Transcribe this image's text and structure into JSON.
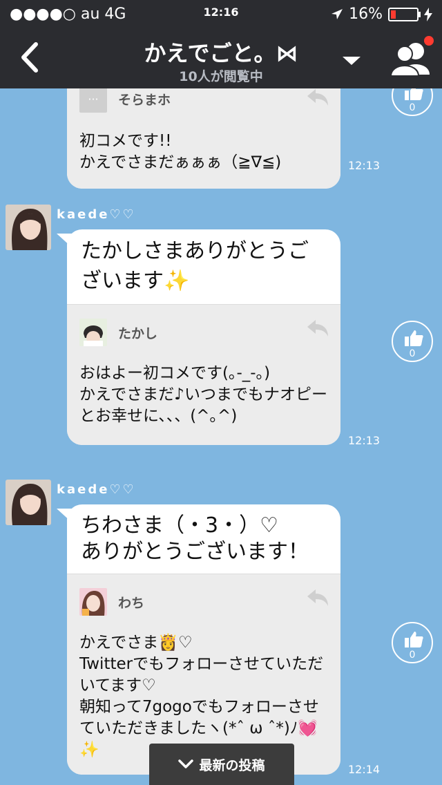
{
  "status": {
    "carrier": "●●●●○ au  4G",
    "time": "12:16",
    "battery_pct": "16%"
  },
  "nav": {
    "title": "かえでごと。⋈",
    "subtitle": "10人が閲覧中"
  },
  "posts": [
    {
      "reply_name": "そらまホ",
      "reply_text": "初コメです!!\nかえでさまだぁぁぁ（≧∇≦)",
      "time": "12:13",
      "likes": "0"
    },
    {
      "poster": "kaede♡♡",
      "main_text": "たかしさまありがとうございます✨",
      "reply_name": "たかし",
      "reply_text": "おはよー初コメです(｡-_-｡)\nかえでさまだ♪いつまでもナオピーとお幸せに、、、(^｡^)",
      "time": "12:13",
      "likes": "0"
    },
    {
      "poster": "kaede♡♡",
      "main_text": "ちわさま（・3・）♡\nありがとうございます！",
      "reply_name": "わち",
      "reply_text": "かえでさま👸♡\nTwitterでもフォローさせていただいてます♡\n朝知って7gogoでもフォローさせていただきましたヽ(*ˆ ω ˆ*)ﾉ💓✨",
      "time": "12:14",
      "likes": "0"
    }
  ],
  "new_posts_label": "最新の投稿"
}
